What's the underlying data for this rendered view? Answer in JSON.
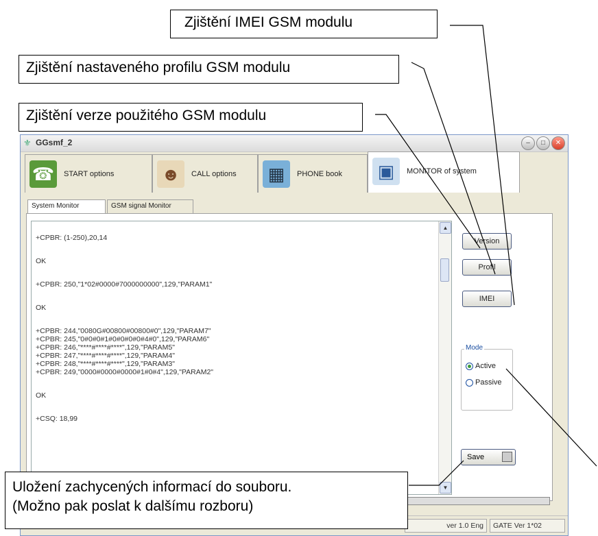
{
  "callouts": {
    "imei": "Zjištění IMEI GSM modulu",
    "profile": "Zjištění nastaveného profilu GSM modulu",
    "version": "Zjištění verze použitého GSM modulu",
    "save_line1": "Uložení zachycených informací do souboru.",
    "save_line2": "(Možno pak poslat k dalšímu rozboru)"
  },
  "window": {
    "title": "GGsmf_2"
  },
  "main_tabs": [
    {
      "label": "START options",
      "icon": "start-icon"
    },
    {
      "label": "CALL options",
      "icon": "call-person-icon"
    },
    {
      "label": "PHONE book",
      "icon": "phonebook-icon"
    },
    {
      "label": "MONITOR of system",
      "icon": "monitor-icon",
      "active": true
    }
  ],
  "sub_tabs": [
    {
      "label": "System Monitor",
      "active": true
    },
    {
      "label": "GSM signal Monitor"
    }
  ],
  "monitor_lines": {
    "l1": "+CPBR: (1-250),20,14",
    "ok1": "OK",
    "l2": "+CPBR: 250,\"1*02#0000#7000000000\",129,\"PARAM1\"",
    "ok2": "OK",
    "l3": "+CPBR: 244,\"0080G#00800#00800#0\",129,\"PARAM7\"",
    "l4": "+CPBR: 245,\"0#0#0#1#0#0#0#0#4#0\",129,\"PARAM6\"",
    "l5": "+CPBR: 246,\"****#****#****\",129,\"PARAM5\"",
    "l6": "+CPBR: 247,\"****#****#****\",129,\"PARAM4\"",
    "l7": "+CPBR: 248,\"****#****#****\",129,\"PARAM3\"",
    "l8": "+CPBR: 249,\"0000#0000#0000#1#0#4\",129,\"PARAM2\"",
    "ok3": "OK",
    "csq": "+CSQ: 18,99"
  },
  "buttons": {
    "version": "Version",
    "profil": "Profil",
    "imei": "IMEI",
    "save": "Save"
  },
  "mode": {
    "legend": "Mode",
    "active": "Active",
    "passive": "Passive",
    "selected": "Active"
  },
  "status": {
    "left": "ver 1.0 Eng",
    "right": "GATE Ver 1*02"
  },
  "colors": {
    "window_border": "#7a96c8",
    "radio_accent": "#1a4ea0"
  }
}
